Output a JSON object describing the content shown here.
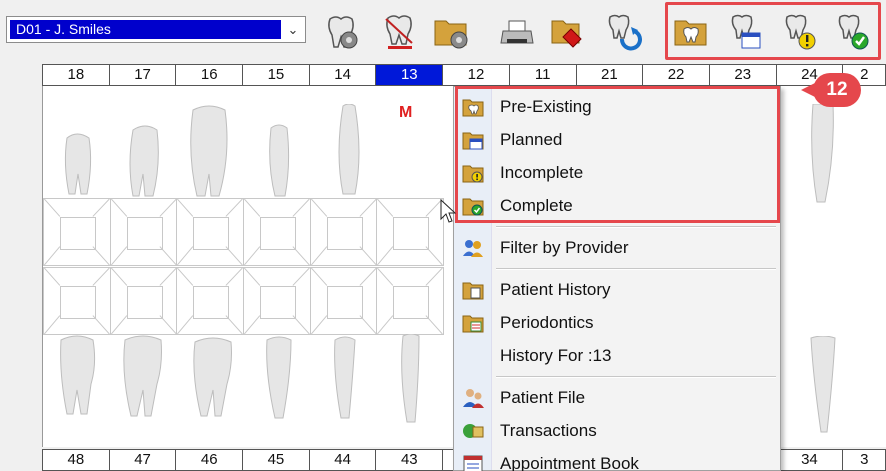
{
  "toolbar": {
    "provider_select": {
      "value": "D01 - J. Smiles"
    },
    "buttons": [
      {
        "name": "tooth-settings-icon"
      },
      {
        "name": "tooth-clear-icon"
      },
      {
        "name": "folder-settings-icon"
      },
      {
        "name": "printer-icon"
      },
      {
        "name": "folder-search-icon"
      },
      {
        "name": "tooth-refresh-icon"
      },
      {
        "name": "pre-existing-folder-icon"
      },
      {
        "name": "planned-calendar-icon"
      },
      {
        "name": "incomplete-warning-icon"
      },
      {
        "name": "complete-check-icon"
      }
    ]
  },
  "upper_numbers": [
    "18",
    "17",
    "16",
    "15",
    "14",
    "13",
    "12",
    "11",
    "21",
    "22",
    "23",
    "24",
    "2"
  ],
  "lower_numbers": [
    "48",
    "47",
    "46",
    "45",
    "44",
    "43",
    "",
    "",
    "",
    "",
    "",
    "34",
    "3"
  ],
  "selected_tooth": "13",
  "chart_marker": "M",
  "badge": "12",
  "context_menu": {
    "items": [
      {
        "label": "Pre-Existing",
        "icon": "pre-existing-icon"
      },
      {
        "label": "Planned",
        "icon": "planned-icon"
      },
      {
        "label": "Incomplete",
        "icon": "incomplete-icon"
      },
      {
        "label": "Complete",
        "icon": "complete-icon"
      },
      {
        "label": "Filter by Provider",
        "icon": "filter-provider-icon"
      },
      {
        "label": "Patient History",
        "icon": "patient-history-icon"
      },
      {
        "label": "Periodontics",
        "icon": "periodontics-icon"
      },
      {
        "label": "History For :13",
        "icon": ""
      },
      {
        "label": "Patient File",
        "icon": "patient-file-icon"
      },
      {
        "label": "Transactions",
        "icon": "transactions-icon"
      },
      {
        "label": "Appointment Book",
        "icon": "appointment-book-icon"
      }
    ]
  },
  "colors": {
    "selection_blue": "#0000cc",
    "highlight_red": "#e5474c"
  }
}
